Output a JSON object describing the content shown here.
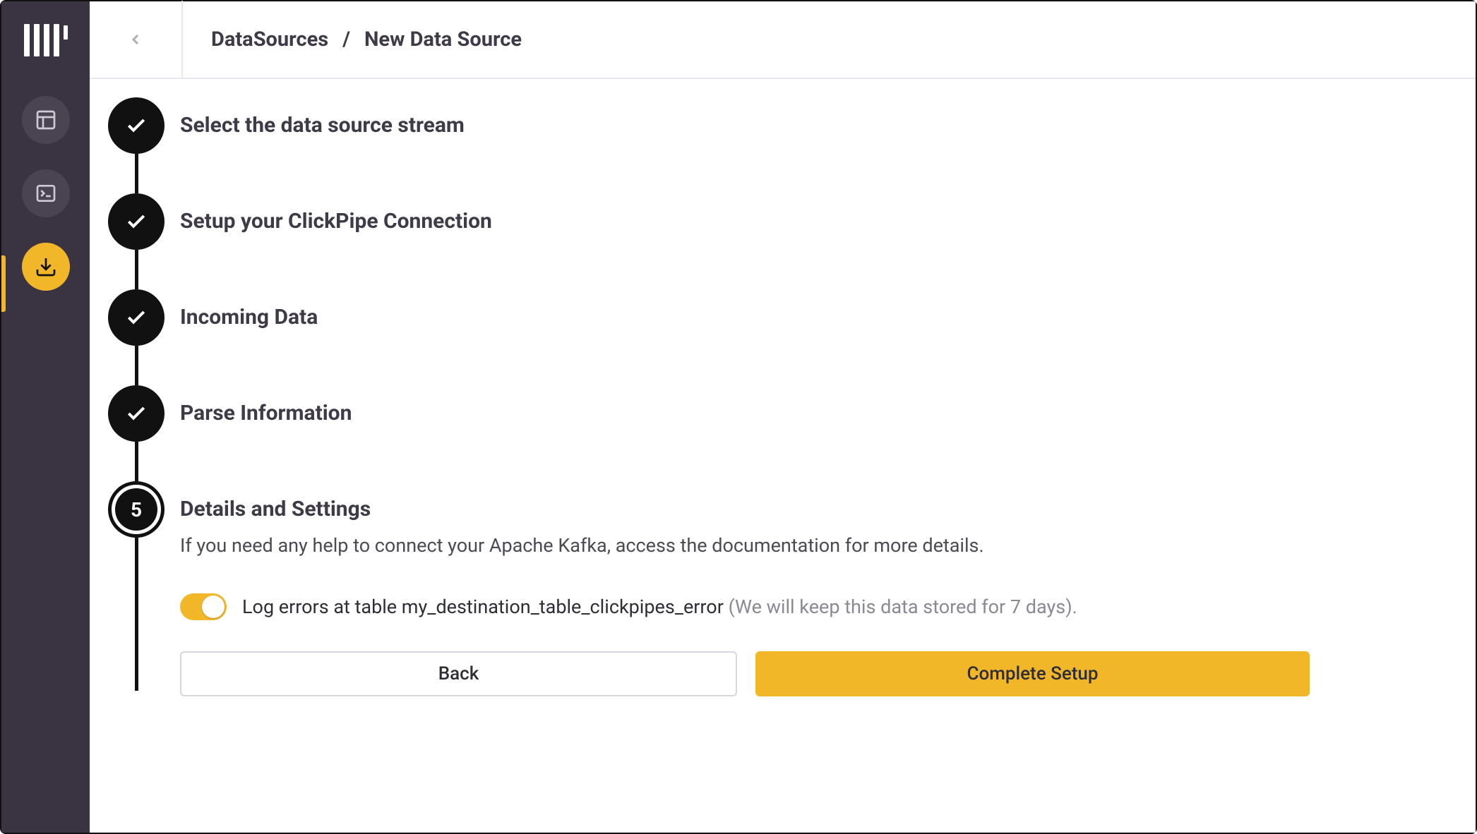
{
  "breadcrumb": {
    "root": "DataSources",
    "separator": "/",
    "current": "New Data Source"
  },
  "steps": [
    {
      "label": "Select the data source stream",
      "state": "done"
    },
    {
      "label": "Setup your ClickPipe Connection",
      "state": "done"
    },
    {
      "label": "Incoming Data",
      "state": "done"
    },
    {
      "label": "Parse Information",
      "state": "done"
    },
    {
      "label": "Details and Settings",
      "state": "active",
      "number": "5",
      "description": "If you need any help to connect your Apache Kafka, access the documentation for more details.",
      "toggle_label": "Log errors at table my_destination_table_clickpipes_error",
      "toggle_note": "(We will keep this data stored for 7 days).",
      "toggle_on": true
    }
  ],
  "buttons": {
    "back": "Back",
    "complete": "Complete Setup"
  }
}
